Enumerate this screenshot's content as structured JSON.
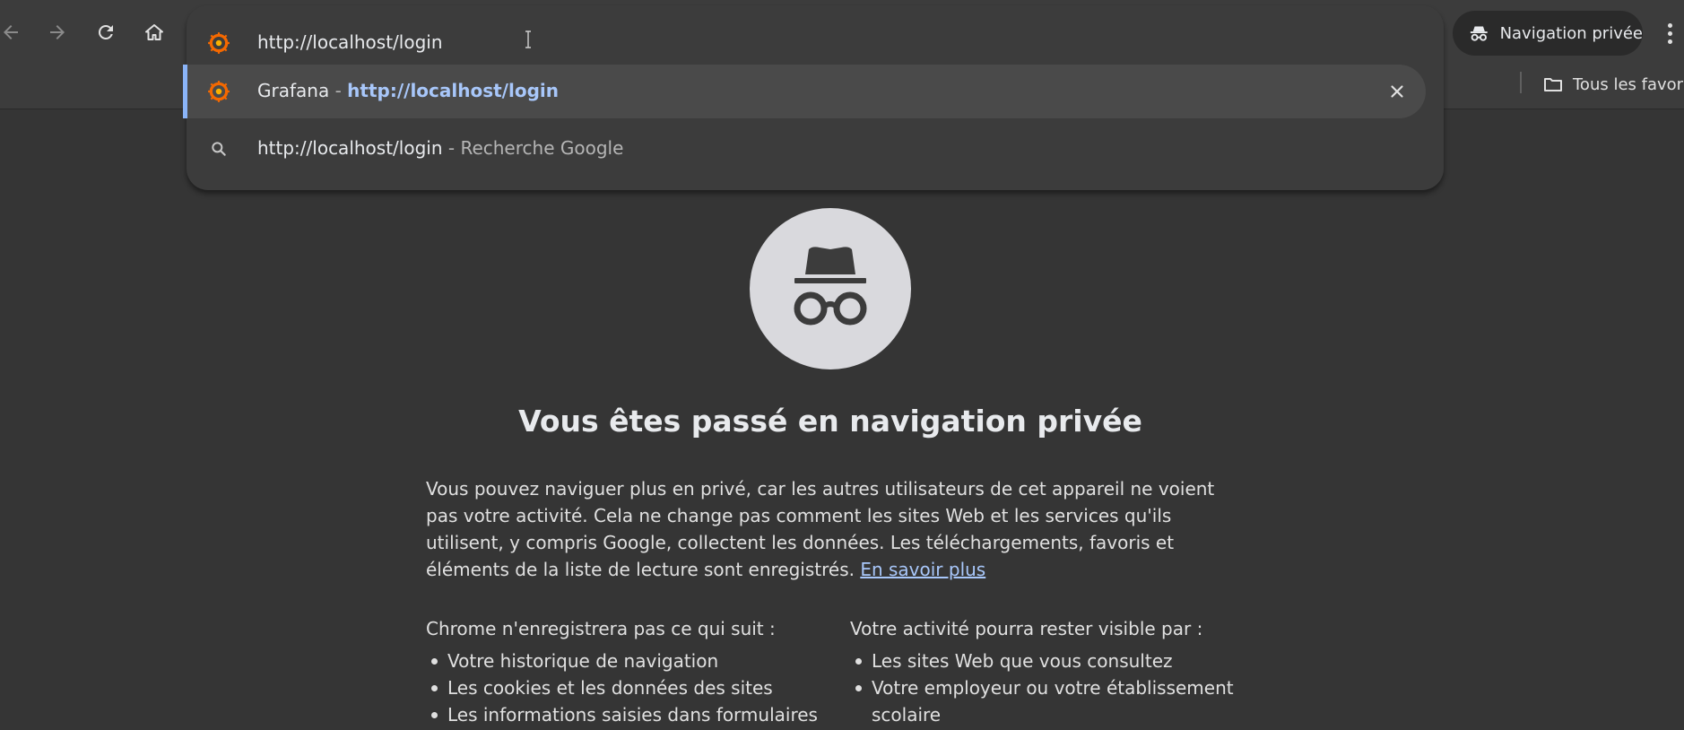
{
  "omnibox": {
    "input_value": "http://localhost/login",
    "suggestions": [
      {
        "title": "Grafana",
        "separator": " - ",
        "url": "http://localhost/login"
      },
      {
        "query": "http://localhost/login",
        "separator": " - ",
        "description": "Recherche Google"
      }
    ]
  },
  "toolbar": {
    "incognito_label": "Navigation privée"
  },
  "bookmarks": {
    "all_bookmarks_label": "Tous les favoris"
  },
  "page": {
    "title": "Vous êtes passé en navigation privée",
    "intro": "Vous pouvez naviguer plus en privé, car les autres utilisateurs de cet appareil ne voient pas votre activité. Cela ne change pas comment les sites Web et les services qu'ils utilisent, y compris Google, collectent les données. Les téléchargements, favoris et éléments de la liste de lecture sont enregistrés.",
    "learn_more": "En savoir plus",
    "not_saved_heading": "Chrome n'enregistrera pas ce qui suit :",
    "not_saved_items": [
      "Votre historique de navigation",
      "Les cookies et les données des sites",
      "Les informations saisies dans formulaires"
    ],
    "visible_heading": "Votre activité pourra rester visible par :",
    "visible_items": [
      "Les sites Web que vous consultez",
      "Votre employeur ou votre établissement scolaire"
    ]
  },
  "colors": {
    "accent": "#8ab4f8",
    "link": "#a8c7fa",
    "grafana_orange": "#f46800",
    "background": "#353535"
  },
  "icons": [
    "back-icon",
    "forward-icon",
    "reload-icon",
    "home-icon",
    "grafana-icon",
    "search-icon",
    "close-icon",
    "incognito-icon",
    "menu-icon",
    "folder-icon"
  ]
}
